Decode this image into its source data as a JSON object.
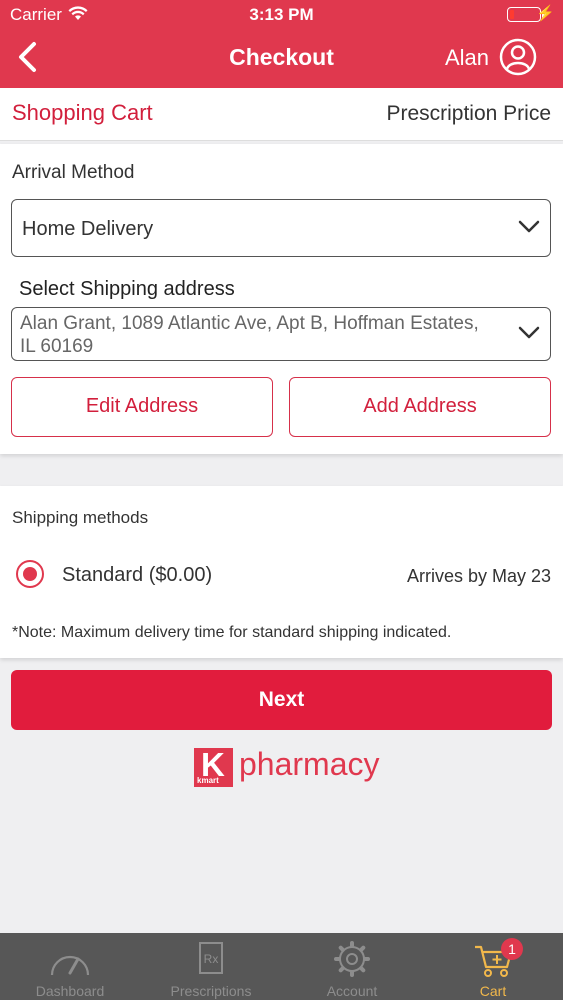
{
  "status_bar": {
    "carrier": "Carrier",
    "time": "3:13 PM"
  },
  "header": {
    "title": "Checkout",
    "user_name": "Alan"
  },
  "cart_header": {
    "left": "Shopping Cart",
    "right": "Prescription Price"
  },
  "arrival": {
    "label": "Arrival Method",
    "selected": "Home Delivery",
    "shipping_label": "Select Shipping address",
    "address": "Alan Grant, 1089 Atlantic Ave, Apt B,  Hoffman Estates, IL 60169",
    "edit_button": "Edit Address",
    "add_button": "Add Address"
  },
  "shipping": {
    "label": "Shipping methods",
    "option": "Standard ($0.00)",
    "arrives": "Arrives by May 23",
    "note": "*Note: Maximum delivery time for standard shipping indicated."
  },
  "next_button": "Next",
  "logo": {
    "letter": "K",
    "small": "kmart",
    "word": "pharmacy"
  },
  "tabs": [
    {
      "label": "Dashboard"
    },
    {
      "label": "Prescriptions"
    },
    {
      "label": "Account"
    },
    {
      "label": "Cart",
      "badge": "1"
    }
  ],
  "colors": {
    "accent": "#e0384e",
    "tab_active": "#f2b84b",
    "tab_bar": "#575757"
  }
}
